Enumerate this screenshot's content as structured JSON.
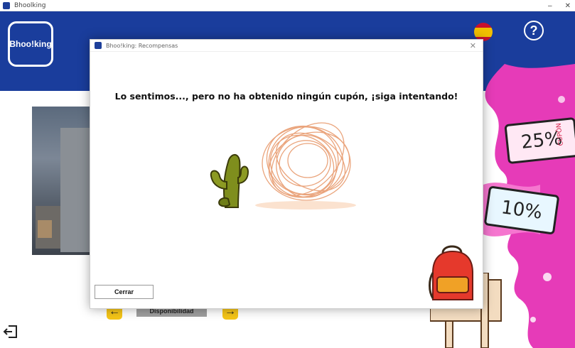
{
  "os_window": {
    "title": "Bhoolking",
    "minimize": "–",
    "close": "✕"
  },
  "header": {
    "logo_text": "Bhoo!king",
    "language_flag_icon": "spain-flag-icon",
    "help_label": "?"
  },
  "page": {
    "availability_button": "Disponibilidad",
    "prev_arrow": "←",
    "next_arrow": "→",
    "coupons": [
      "25%",
      "10%"
    ],
    "coupon_side_label": "CUPÓN"
  },
  "modal": {
    "title": "Bhoo!king: Recompensas",
    "close_icon": "✕",
    "message": "Lo sentimos..., pero no ha obtenido ningún cupón, ¡siga intentando!",
    "close_button": "Cerrar"
  },
  "colors": {
    "brand_blue": "#1a3d9c",
    "accent_yellow": "#f5c518",
    "pink_slime": "#e63bb8"
  }
}
